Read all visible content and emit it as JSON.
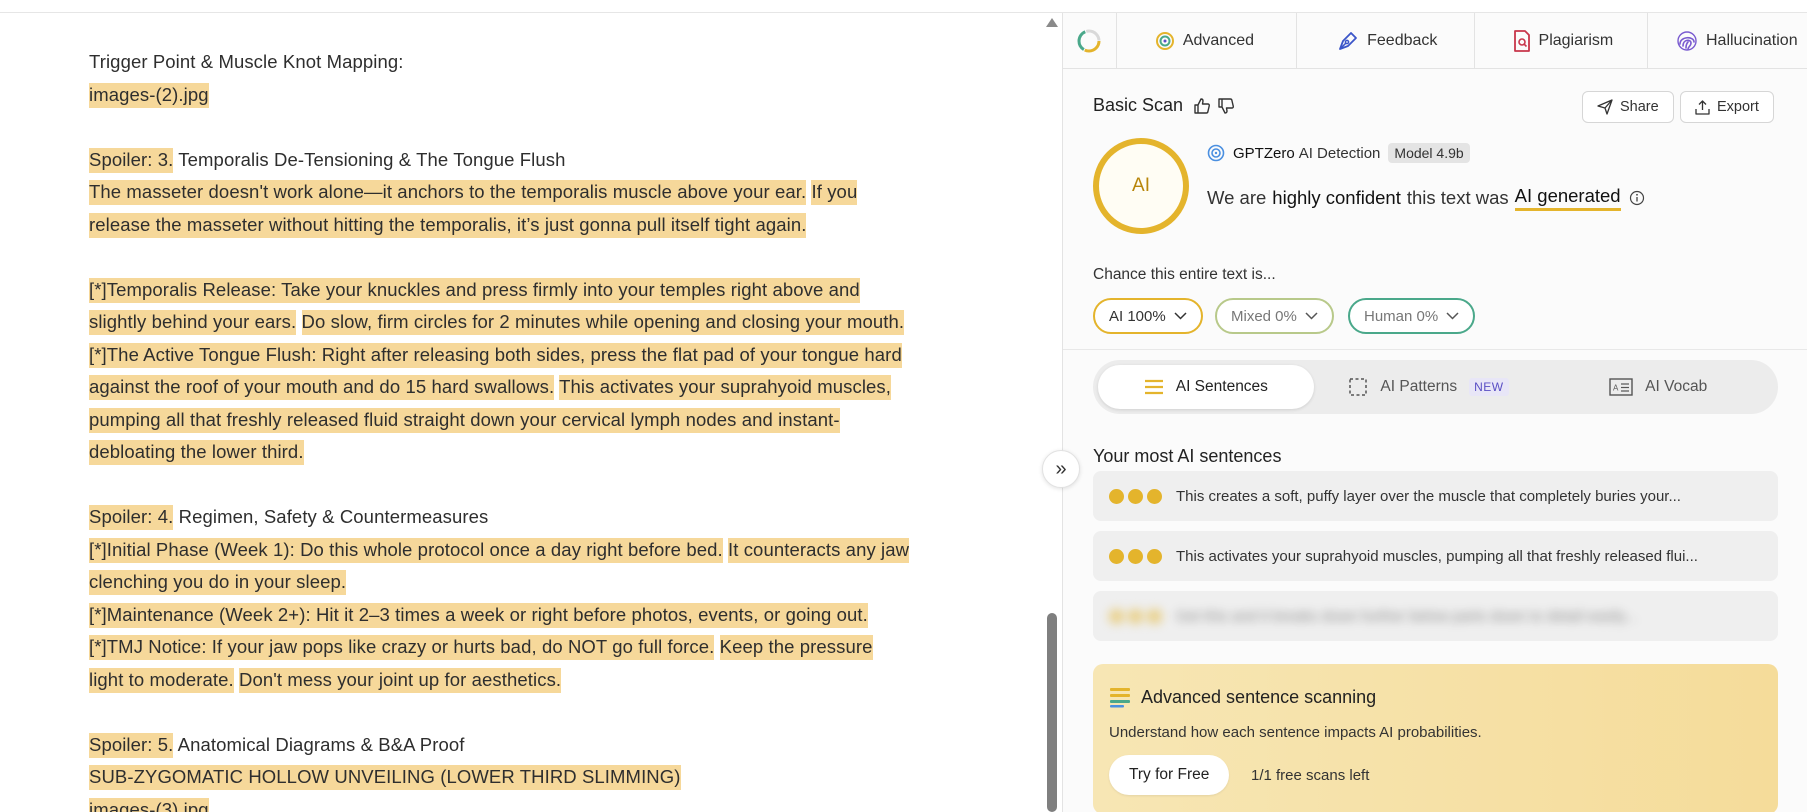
{
  "document": {
    "lines": [
      [
        {
          "t": "Trigger Point & Muscle Knot Mapping:",
          "h": false
        }
      ],
      [
        {
          "t": "images-(2).jpg",
          "h": true
        }
      ],
      [],
      [
        {
          "t": "Spoiler: 3.",
          "h": true
        },
        {
          "t": " Temporalis De-Tensioning & The Tongue Flush",
          "h": false
        }
      ],
      [
        {
          "t": "The masseter doesn't work alone—it anchors to the temporalis muscle above your ear.",
          "h": true
        },
        {
          "t": " ",
          "h": false
        },
        {
          "t": "If you",
          "h": true
        }
      ],
      [
        {
          "t": "release the masseter without hitting the temporalis, it’s just gonna pull itself tight again.",
          "h": true
        }
      ],
      [],
      [
        {
          "t": "[*]Temporalis Release: Take your knuckles and press firmly into your temples right above and",
          "h": true
        }
      ],
      [
        {
          "t": "slightly behind your ears.",
          "h": true
        },
        {
          "t": " ",
          "h": false
        },
        {
          "t": "Do slow, firm circles for 2 minutes while opening and closing your mouth.",
          "h": true
        }
      ],
      [
        {
          "t": "[*]The Active Tongue Flush: Right after releasing both sides, press the flat pad of your tongue hard",
          "h": true
        }
      ],
      [
        {
          "t": "against the roof of your mouth and do 15 hard swallows.",
          "h": true
        },
        {
          "t": " ",
          "h": false
        },
        {
          "t": "This activates your suprahyoid muscles,",
          "h": true
        }
      ],
      [
        {
          "t": "pumping all that freshly released fluid straight down your cervical lymph nodes and instant-",
          "h": true
        }
      ],
      [
        {
          "t": "debloating the lower third.",
          "h": true
        }
      ],
      [],
      [
        {
          "t": "Spoiler: 4.",
          "h": true
        },
        {
          "t": " Regimen, Safety & Countermeasures",
          "h": false
        }
      ],
      [
        {
          "t": "[*]Initial Phase (Week 1): Do this whole protocol once a day right before bed.",
          "h": true
        },
        {
          "t": " ",
          "h": false
        },
        {
          "t": "It counteracts any jaw",
          "h": true
        }
      ],
      [
        {
          "t": "clenching you do in your sleep.",
          "h": true
        }
      ],
      [
        {
          "t": "[*]Maintenance (Week 2+): Hit it 2–3 times a week or right before photos, events, or going out.",
          "h": true
        }
      ],
      [
        {
          "t": "[*]TMJ Notice: If your jaw pops like crazy or hurts bad, do NOT go full force.",
          "h": true
        },
        {
          "t": " ",
          "h": false
        },
        {
          "t": "Keep the pressure",
          "h": true
        }
      ],
      [
        {
          "t": "light to moderate.",
          "h": true
        },
        {
          "t": " ",
          "h": false
        },
        {
          "t": "Don't mess your joint up for aesthetics.",
          "h": true
        }
      ],
      [],
      [
        {
          "t": "Spoiler: 5.",
          "h": true
        },
        {
          "t": " Anatomical Diagrams & B&A Proof",
          "h": false
        }
      ],
      [
        {
          "t": "SUB-ZYGOMATIC HOLLOW UNVEILING (LOWER THIRD SLIMMING)",
          "h": true
        }
      ],
      [
        {
          "t": "images-(3).jpg",
          "h": true
        }
      ]
    ]
  },
  "tabs": {
    "advanced": "Advanced",
    "feedback": "Feedback",
    "plagiarism": "Plagiarism",
    "hallucination": "Hallucination"
  },
  "scan": {
    "title": "Basic Scan",
    "share": "Share",
    "export": "Export",
    "ring_label": "AI",
    "detector": "GPTZero",
    "detector_suffix": "AI Detection",
    "model": "Model 4.9b",
    "confidence_prefix": "We are",
    "confidence_strong": "highly confident",
    "confidence_mid": "this text was",
    "confidence_result": "AI generated"
  },
  "chance": {
    "label": "Chance this entire text is...",
    "ai": "AI 100%",
    "mixed": "Mixed 0%",
    "human": "Human 0%",
    "ai_value": 100,
    "mixed_value": 0,
    "human_value": 0
  },
  "segments": {
    "sentences": "AI Sentences",
    "patterns": "AI Patterns",
    "new_badge": "NEW",
    "vocab": "AI Vocab"
  },
  "most": {
    "title": "Your most AI sentences",
    "items": [
      "This creates a soft, puffy layer over the muscle that completely buries your...",
      "This activates your suprahyoid muscles, pumping all that freshly released flui...",
      "Get this and it breaks down further below parts down to detail easily..."
    ]
  },
  "upsell": {
    "title": "Advanced sentence scanning",
    "desc": "Understand how each sentence impacts AI probabilities.",
    "cta": "Try for Free",
    "scans_left": "1/1 free scans left"
  },
  "colors": {
    "highlight": "#f6d89a",
    "ai_gold": "#e4b42c",
    "human_green": "#4aa88a"
  }
}
